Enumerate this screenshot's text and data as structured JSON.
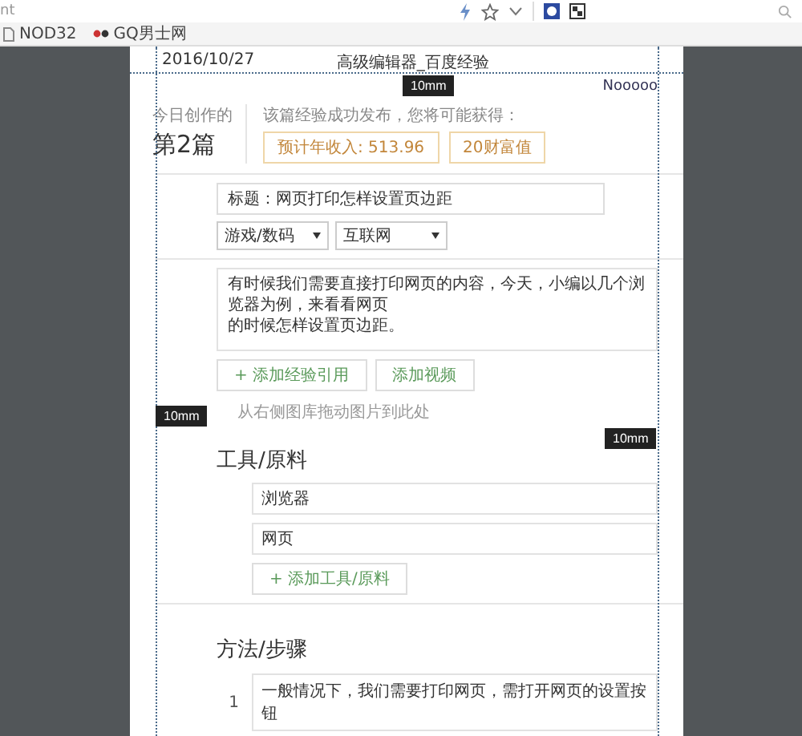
{
  "browser": {
    "address_fragment": "nt",
    "bookmarks": [
      {
        "label": "NOD32",
        "kind": "page"
      },
      {
        "label": "GQ男士网",
        "kind": "link"
      }
    ]
  },
  "print_preview": {
    "margin_labels": [
      {
        "text": "10mm",
        "kind": "top"
      },
      {
        "text": "10mm",
        "kind": "left"
      },
      {
        "text": "10mm",
        "kind": "right"
      }
    ],
    "page": {
      "header_date": "2016/10/27",
      "header_title": "高级编辑器_百度经验",
      "user_name": "Nooooo",
      "today_label": "今日创作的",
      "today_count": "第2篇",
      "reward_prompt": "该篇经验成功发布，您将可能获得：",
      "rewards": [
        "预计年收入: 513.96",
        "20财富值"
      ],
      "title_field": {
        "value": "标题：网页打印怎样设置页边距"
      },
      "categories": [
        "游戏/数码",
        "互联网"
      ],
      "intro_lines": [
        "有时候我们需要直接打印网页的内容，今天，小编以几个浏览器为例，来看看网页",
        "的时候怎样设置页边距。"
      ],
      "intro_buttons": [
        "+ 添加经验引用",
        "添加视频"
      ],
      "image_hint": "从右侧图库拖动图片到此处",
      "tools_heading": "工具/原料",
      "tools": [
        "浏览器",
        "网页"
      ],
      "add_tool_button": "+ 添加工具/原料",
      "steps_heading": "方法/步骤",
      "steps": [
        {
          "number": "1",
          "text": "一般情况下，我们需要打印网页，需打开网页的设置按钮"
        }
      ]
    }
  }
}
